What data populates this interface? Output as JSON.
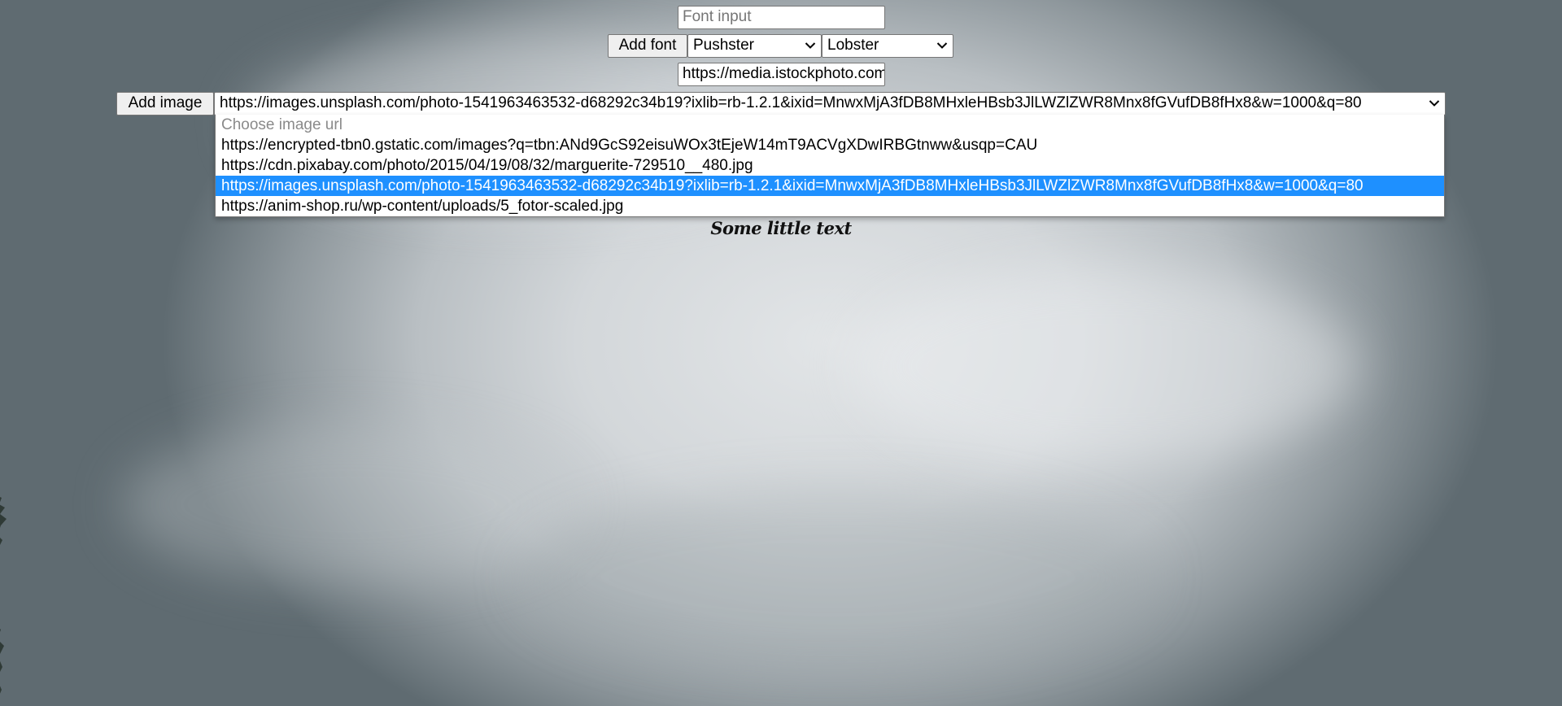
{
  "font_form": {
    "font_input_placeholder": "Font input",
    "add_font_label": "Add font",
    "font_select_1_value": "Pushster",
    "font_select_2_value": "Lobster"
  },
  "image_form": {
    "image_url_input_value": "https://media.istockphoto.com",
    "add_image_label": "Add image",
    "image_select_value": "https://images.unsplash.com/photo-1541963463532-d68292c34b19?ixlib=rb-1.2.1&ixid=MnwxMjA3fDB8MHxleHBsb3JlLWZlZWR8Mnx8fGVufDB8fHx8&w=1000&q=80",
    "options": [
      "Choose image url",
      "https://encrypted-tbn0.gstatic.com/images?q=tbn:ANd9GcS92eisuWOx3tEjeW14mT9ACVgXDwIRBGtnww&usqp=CAU",
      "https://cdn.pixabay.com/photo/2015/04/19/08/32/marguerite-729510__480.jpg",
      "https://images.unsplash.com/photo-1541963463532-d68292c34b19?ixlib=rb-1.2.1&ixid=MnwxMjA3fDB8MHxleHBsb3JlLWZlZWR8Mnx8fGVufDB8fHx8&w=1000&q=80",
      "https://anim-shop.ru/wp-content/uploads/5_fotor-scaled.jpg"
    ],
    "selected_index": 3
  },
  "caption_text": "Some little text",
  "colors": {
    "selection_blue": "#1e90ff",
    "button_bg": "#efefef",
    "border_gray": "#767676"
  },
  "icons": {
    "select_arrow": "chevron-down-icon"
  }
}
